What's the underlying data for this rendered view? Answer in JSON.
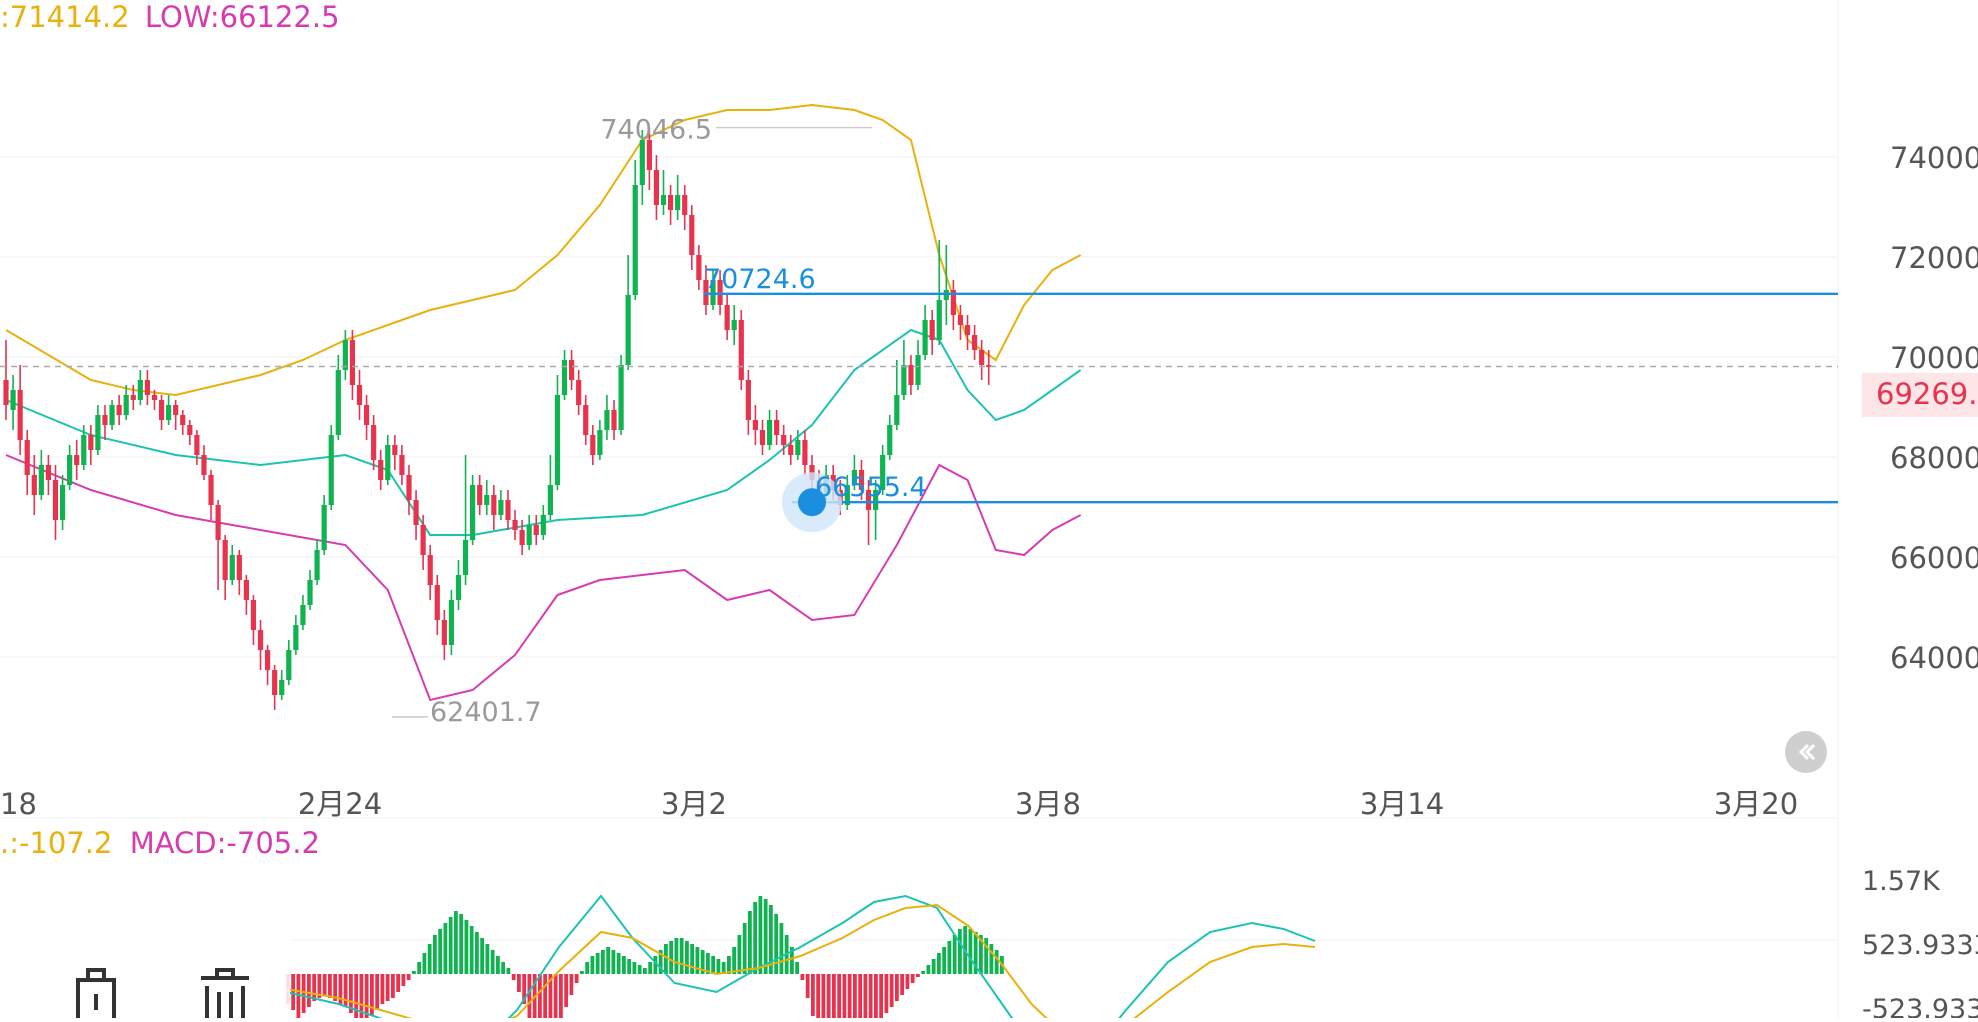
{
  "top_indicator": {
    "high_text": ":71414.2",
    "low_text": "LOW:66122.5"
  },
  "macd_indicator": {
    "dea_text": ".:-107.2",
    "macd_text": "MACD:-705.2"
  },
  "colors": {
    "up": "#0fb350",
    "down": "#e8334e",
    "upper_band": "#e8b10c",
    "mid_band": "#1cc4b0",
    "lower_band": "#d63cb0",
    "hline": "#1a8fe0",
    "price_tag": "#e8334e"
  },
  "icons": {
    "rewind": "double-chevron-left-icon",
    "tool_a": "lock-icon",
    "tool_b": "trash-icon"
  },
  "chart_data": {
    "type": "candlestick",
    "price_axis": {
      "ticks": [
        "74000",
        "72000",
        "70000",
        "68000",
        "66000",
        "64000"
      ],
      "range": [
        61200,
        75800
      ]
    },
    "date_axis": {
      "ticks": [
        "18",
        "2月24",
        "3月2",
        "3月8",
        "3月14",
        "3月20"
      ]
    },
    "last_price": "69269.",
    "annotations": {
      "high": "74046.5",
      "low": "62401.7",
      "level_upper": "70724.6",
      "level_lower": "66555.4"
    },
    "levels": [
      70724.6,
      66555.4
    ],
    "candles": [
      [
        69000,
        68500,
        68200,
        69800
      ],
      [
        68400,
        68800,
        68000,
        69100
      ],
      [
        68800,
        67800,
        67500,
        69300
      ],
      [
        67800,
        67100,
        66700,
        68000
      ],
      [
        67100,
        66700,
        66300,
        67500
      ],
      [
        66700,
        67300,
        66600,
        67600
      ],
      [
        67300,
        67000,
        66700,
        67500
      ],
      [
        67000,
        66200,
        65800,
        67300
      ],
      [
        66200,
        66900,
        66000,
        67100
      ],
      [
        66900,
        67500,
        66800,
        67700
      ],
      [
        67500,
        67300,
        67000,
        67800
      ],
      [
        67300,
        67900,
        67200,
        68100
      ],
      [
        67900,
        67600,
        67300,
        68100
      ],
      [
        67600,
        68300,
        67500,
        68500
      ],
      [
        68300,
        68100,
        67800,
        68500
      ],
      [
        68100,
        68500,
        68000,
        68600
      ],
      [
        68500,
        68300,
        68100,
        68700
      ],
      [
        68300,
        68700,
        68200,
        68900
      ],
      [
        68700,
        68600,
        68400,
        68900
      ],
      [
        68600,
        69000,
        68500,
        69200
      ],
      [
        69000,
        68700,
        68500,
        69200
      ],
      [
        68700,
        68600,
        68400,
        68800
      ],
      [
        68600,
        68200,
        68000,
        68700
      ],
      [
        68200,
        68500,
        68100,
        68700
      ],
      [
        68500,
        68300,
        68000,
        68600
      ],
      [
        68300,
        68100,
        67900,
        68400
      ],
      [
        68100,
        67900,
        67700,
        68200
      ],
      [
        67900,
        67500,
        67300,
        68000
      ],
      [
        67500,
        67100,
        67000,
        67700
      ],
      [
        67100,
        66500,
        66200,
        67200
      ],
      [
        66500,
        65800,
        64800,
        66600
      ],
      [
        65800,
        65000,
        64600,
        65900
      ],
      [
        65000,
        65500,
        64900,
        65700
      ],
      [
        65500,
        65000,
        64700,
        65600
      ],
      [
        65000,
        64600,
        64300,
        65100
      ],
      [
        64600,
        64000,
        63700,
        64700
      ],
      [
        64000,
        63600,
        63200,
        64200
      ],
      [
        63600,
        63200,
        62900,
        63700
      ],
      [
        63200,
        62700,
        62400,
        63300
      ],
      [
        62700,
        63000,
        62600,
        63200
      ],
      [
        63000,
        63600,
        62900,
        63800
      ],
      [
        63600,
        64100,
        63500,
        64300
      ],
      [
        64100,
        64500,
        64000,
        64700
      ],
      [
        64500,
        65000,
        64400,
        65200
      ],
      [
        65000,
        65600,
        64900,
        65800
      ],
      [
        65600,
        66500,
        65500,
        66700
      ],
      [
        66500,
        67900,
        66400,
        68100
      ],
      [
        67900,
        69200,
        67800,
        69500
      ],
      [
        69200,
        69800,
        69000,
        70000
      ],
      [
        69800,
        68900,
        68600,
        70000
      ],
      [
        68900,
        68500,
        68200,
        69200
      ],
      [
        68500,
        68100,
        67800,
        68700
      ],
      [
        68100,
        67400,
        67200,
        68300
      ],
      [
        67400,
        67000,
        66800,
        67600
      ],
      [
        67000,
        67700,
        66900,
        67900
      ],
      [
        67700,
        67500,
        67200,
        67900
      ],
      [
        67500,
        67100,
        66900,
        67700
      ],
      [
        67100,
        66600,
        66300,
        67300
      ],
      [
        66600,
        66100,
        65800,
        66800
      ],
      [
        66100,
        65500,
        65200,
        66300
      ],
      [
        65500,
        64900,
        64600,
        65700
      ],
      [
        64900,
        64200,
        63900,
        65100
      ],
      [
        64200,
        63700,
        63400,
        64400
      ],
      [
        63700,
        64600,
        63500,
        64800
      ],
      [
        64600,
        65100,
        64400,
        65400
      ],
      [
        65100,
        65800,
        64900,
        67500
      ],
      [
        65800,
        66900,
        65700,
        67100
      ],
      [
        66900,
        66500,
        66300,
        67100
      ],
      [
        66500,
        66700,
        66300,
        67000
      ],
      [
        66700,
        66300,
        66000,
        66900
      ],
      [
        66300,
        66600,
        66200,
        66800
      ],
      [
        66600,
        66200,
        66000,
        66800
      ],
      [
        66200,
        66000,
        65800,
        66400
      ],
      [
        66000,
        65700,
        65500,
        66200
      ],
      [
        65700,
        66100,
        65600,
        66300
      ],
      [
        66100,
        65900,
        65700,
        66300
      ],
      [
        65900,
        66300,
        65800,
        66500
      ],
      [
        66300,
        66900,
        66200,
        67500
      ],
      [
        66900,
        68700,
        66800,
        69100
      ],
      [
        68700,
        69400,
        68600,
        69600
      ],
      [
        69400,
        69000,
        68800,
        69600
      ],
      [
        69000,
        68500,
        68300,
        69200
      ],
      [
        68500,
        67900,
        67700,
        68700
      ],
      [
        67900,
        67500,
        67300,
        68100
      ],
      [
        67500,
        68000,
        67400,
        68200
      ],
      [
        68000,
        68400,
        67800,
        68700
      ],
      [
        68400,
        68000,
        67800,
        68600
      ],
      [
        68000,
        69300,
        67900,
        69500
      ],
      [
        69300,
        70700,
        69200,
        71500
      ],
      [
        70700,
        72900,
        70600,
        73400
      ],
      [
        72900,
        73800,
        72500,
        74000
      ],
      [
        73800,
        73200,
        72800,
        74046
      ],
      [
        73200,
        72500,
        72200,
        73500
      ],
      [
        72500,
        72700,
        72300,
        73200
      ],
      [
        72700,
        72400,
        72100,
        72900
      ],
      [
        72400,
        72700,
        72200,
        73100
      ],
      [
        72700,
        72300,
        72000,
        72900
      ],
      [
        72300,
        71500,
        71200,
        72500
      ],
      [
        71500,
        71000,
        70800,
        71700
      ],
      [
        71000,
        70500,
        70300,
        71300
      ],
      [
        70500,
        71000,
        70400,
        71200
      ],
      [
        71000,
        70500,
        70300,
        71200
      ],
      [
        70500,
        70000,
        69800,
        70700
      ],
      [
        70000,
        70200,
        69700,
        70500
      ],
      [
        70200,
        69000,
        68800,
        70400
      ],
      [
        69000,
        68200,
        67900,
        69200
      ],
      [
        68200,
        68000,
        67700,
        68500
      ],
      [
        68000,
        67700,
        67500,
        68200
      ],
      [
        67700,
        68200,
        67600,
        68400
      ],
      [
        68200,
        67900,
        67700,
        68400
      ],
      [
        67900,
        67700,
        67500,
        68100
      ],
      [
        67700,
        67500,
        67300,
        67900
      ],
      [
        67500,
        67800,
        67400,
        68000
      ],
      [
        67800,
        67300,
        67100,
        68000
      ],
      [
        67300,
        67000,
        66800,
        67500
      ],
      [
        67000,
        66700,
        66500,
        67200
      ],
      [
        66700,
        67100,
        66600,
        67300
      ],
      [
        67100,
        66800,
        66600,
        67300
      ],
      [
        66800,
        66500,
        66300,
        67000
      ],
      [
        66500,
        66900,
        66400,
        67100
      ],
      [
        66900,
        67200,
        66800,
        67500
      ],
      [
        67200,
        66800,
        66600,
        67400
      ],
      [
        66800,
        66400,
        65700,
        67000
      ],
      [
        66400,
        66800,
        65800,
        67000
      ],
      [
        66800,
        67500,
        66700,
        67700
      ],
      [
        67500,
        68100,
        67400,
        68300
      ],
      [
        68100,
        68700,
        68000,
        69400
      ],
      [
        68700,
        69300,
        68600,
        69800
      ],
      [
        69300,
        68900,
        68700,
        69500
      ],
      [
        68900,
        69500,
        68800,
        69800
      ],
      [
        69500,
        70200,
        69400,
        70500
      ],
      [
        70200,
        69800,
        69500,
        70400
      ],
      [
        69800,
        70600,
        69700,
        71800
      ],
      [
        70600,
        70800,
        70100,
        71700
      ],
      [
        70800,
        70300,
        70000,
        71000
      ],
      [
        70300,
        70100,
        69800,
        70500
      ],
      [
        70100,
        69900,
        69600,
        70300
      ],
      [
        69900,
        69600,
        69400,
        70100
      ],
      [
        69600,
        69300,
        69000,
        69800
      ],
      [
        69300,
        69269,
        68900,
        69600
      ]
    ],
    "upper_band": [
      [
        0,
        70000
      ],
      [
        6,
        69500
      ],
      [
        12,
        69000
      ],
      [
        18,
        68800
      ],
      [
        24,
        68700
      ],
      [
        30,
        68900
      ],
      [
        36,
        69100
      ],
      [
        42,
        69400
      ],
      [
        48,
        69800
      ],
      [
        54,
        70100
      ],
      [
        60,
        70400
      ],
      [
        66,
        70600
      ],
      [
        72,
        70800
      ],
      [
        78,
        71500
      ],
      [
        84,
        72500
      ],
      [
        90,
        73800
      ],
      [
        96,
        74200
      ],
      [
        102,
        74400
      ],
      [
        108,
        74400
      ],
      [
        114,
        74500
      ],
      [
        120,
        74400
      ],
      [
        124,
        74200
      ],
      [
        128,
        73800
      ],
      [
        132,
        71500
      ],
      [
        136,
        69800
      ],
      [
        140,
        69400
      ],
      [
        144,
        70500
      ],
      [
        148,
        71200
      ],
      [
        152,
        71500
      ]
    ],
    "mid_band": [
      [
        0,
        68600
      ],
      [
        12,
        67900
      ],
      [
        24,
        67500
      ],
      [
        36,
        67300
      ],
      [
        48,
        67500
      ],
      [
        54,
        67200
      ],
      [
        60,
        65900
      ],
      [
        66,
        65900
      ],
      [
        78,
        66200
      ],
      [
        90,
        66300
      ],
      [
        102,
        66800
      ],
      [
        108,
        67400
      ],
      [
        114,
        68100
      ],
      [
        120,
        69200
      ],
      [
        124,
        69600
      ],
      [
        128,
        70000
      ],
      [
        132,
        69800
      ],
      [
        136,
        68800
      ],
      [
        140,
        68200
      ],
      [
        144,
        68400
      ],
      [
        148,
        68800
      ],
      [
        152,
        69200
      ]
    ],
    "lower_band": [
      [
        0,
        67500
      ],
      [
        12,
        66800
      ],
      [
        24,
        66300
      ],
      [
        36,
        66000
      ],
      [
        48,
        65700
      ],
      [
        54,
        64800
      ],
      [
        60,
        62600
      ],
      [
        66,
        62800
      ],
      [
        72,
        63500
      ],
      [
        78,
        64700
      ],
      [
        84,
        65000
      ],
      [
        90,
        65100
      ],
      [
        96,
        65200
      ],
      [
        102,
        64600
      ],
      [
        108,
        64800
      ],
      [
        114,
        64200
      ],
      [
        120,
        64300
      ],
      [
        126,
        65700
      ],
      [
        132,
        67300
      ],
      [
        136,
        67000
      ],
      [
        140,
        65600
      ],
      [
        144,
        65500
      ],
      [
        148,
        66000
      ],
      [
        152,
        66300
      ]
    ],
    "macd": {
      "axis_ticks": [
        "1.57K",
        "523.9333",
        "-523.933"
      ],
      "hist": [
        -100,
        -120,
        -150,
        -130,
        -110,
        -90,
        -80,
        -70,
        -80,
        -90,
        -100,
        -110,
        -130,
        -150,
        -170,
        -160,
        -140,
        -120,
        -100,
        -90,
        -80,
        -60,
        -40,
        -20,
        10,
        40,
        70,
        100,
        130,
        150,
        170,
        190,
        210,
        200,
        180,
        160,
        140,
        120,
        100,
        80,
        60,
        40,
        20,
        -20,
        -60,
        -100,
        -150,
        -200,
        -230,
        -260,
        -230,
        -190,
        -150,
        -110,
        -70,
        -30,
        10,
        40,
        60,
        70,
        80,
        90,
        80,
        70,
        60,
        50,
        40,
        30,
        20,
        40,
        60,
        80,
        100,
        110,
        120,
        120,
        110,
        100,
        90,
        80,
        70,
        60,
        50,
        40,
        60,
        90,
        130,
        170,
        210,
        240,
        260,
        250,
        230,
        200,
        170,
        130,
        90,
        40,
        -20,
        -80,
        -140,
        -200,
        -240,
        -270,
        -290,
        -300,
        -290,
        -270,
        -250,
        -230,
        -210,
        -190,
        -170,
        -150,
        -130,
        -110,
        -90,
        -70,
        -50,
        -30,
        -10,
        10,
        30,
        50,
        70,
        90,
        110,
        130,
        150,
        160,
        150,
        140,
        130,
        120,
        100,
        80,
        60
      ],
      "dif": [
        [
          0,
          -60
        ],
        [
          10,
          -100
        ],
        [
          20,
          -160
        ],
        [
          30,
          -220
        ],
        [
          36,
          -260
        ],
        [
          44,
          -120
        ],
        [
          52,
          90
        ],
        [
          60,
          260
        ],
        [
          66,
          120
        ],
        [
          74,
          -30
        ],
        [
          82,
          -60
        ],
        [
          90,
          20
        ],
        [
          98,
          90
        ],
        [
          106,
          170
        ],
        [
          112,
          240
        ],
        [
          118,
          260
        ],
        [
          124,
          220
        ],
        [
          130,
          60
        ],
        [
          136,
          -90
        ],
        [
          142,
          -240
        ],
        [
          148,
          -300
        ],
        [
          154,
          -250
        ],
        [
          160,
          -120
        ],
        [
          168,
          40
        ],
        [
          176,
          140
        ],
        [
          184,
          170
        ],
        [
          190,
          150
        ],
        [
          196,
          110
        ]
      ],
      "dea": [
        [
          0,
          -50
        ],
        [
          10,
          -80
        ],
        [
          20,
          -130
        ],
        [
          30,
          -180
        ],
        [
          36,
          -200
        ],
        [
          44,
          -140
        ],
        [
          52,
          10
        ],
        [
          60,
          140
        ],
        [
          66,
          120
        ],
        [
          74,
          40
        ],
        [
          82,
          0
        ],
        [
          90,
          20
        ],
        [
          98,
          60
        ],
        [
          106,
          120
        ],
        [
          112,
          180
        ],
        [
          118,
          220
        ],
        [
          124,
          230
        ],
        [
          130,
          160
        ],
        [
          136,
          40
        ],
        [
          142,
          -100
        ],
        [
          148,
          -200
        ],
        [
          154,
          -220
        ],
        [
          160,
          -170
        ],
        [
          168,
          -60
        ],
        [
          176,
          40
        ],
        [
          184,
          90
        ],
        [
          190,
          100
        ],
        [
          196,
          90
        ]
      ]
    }
  }
}
